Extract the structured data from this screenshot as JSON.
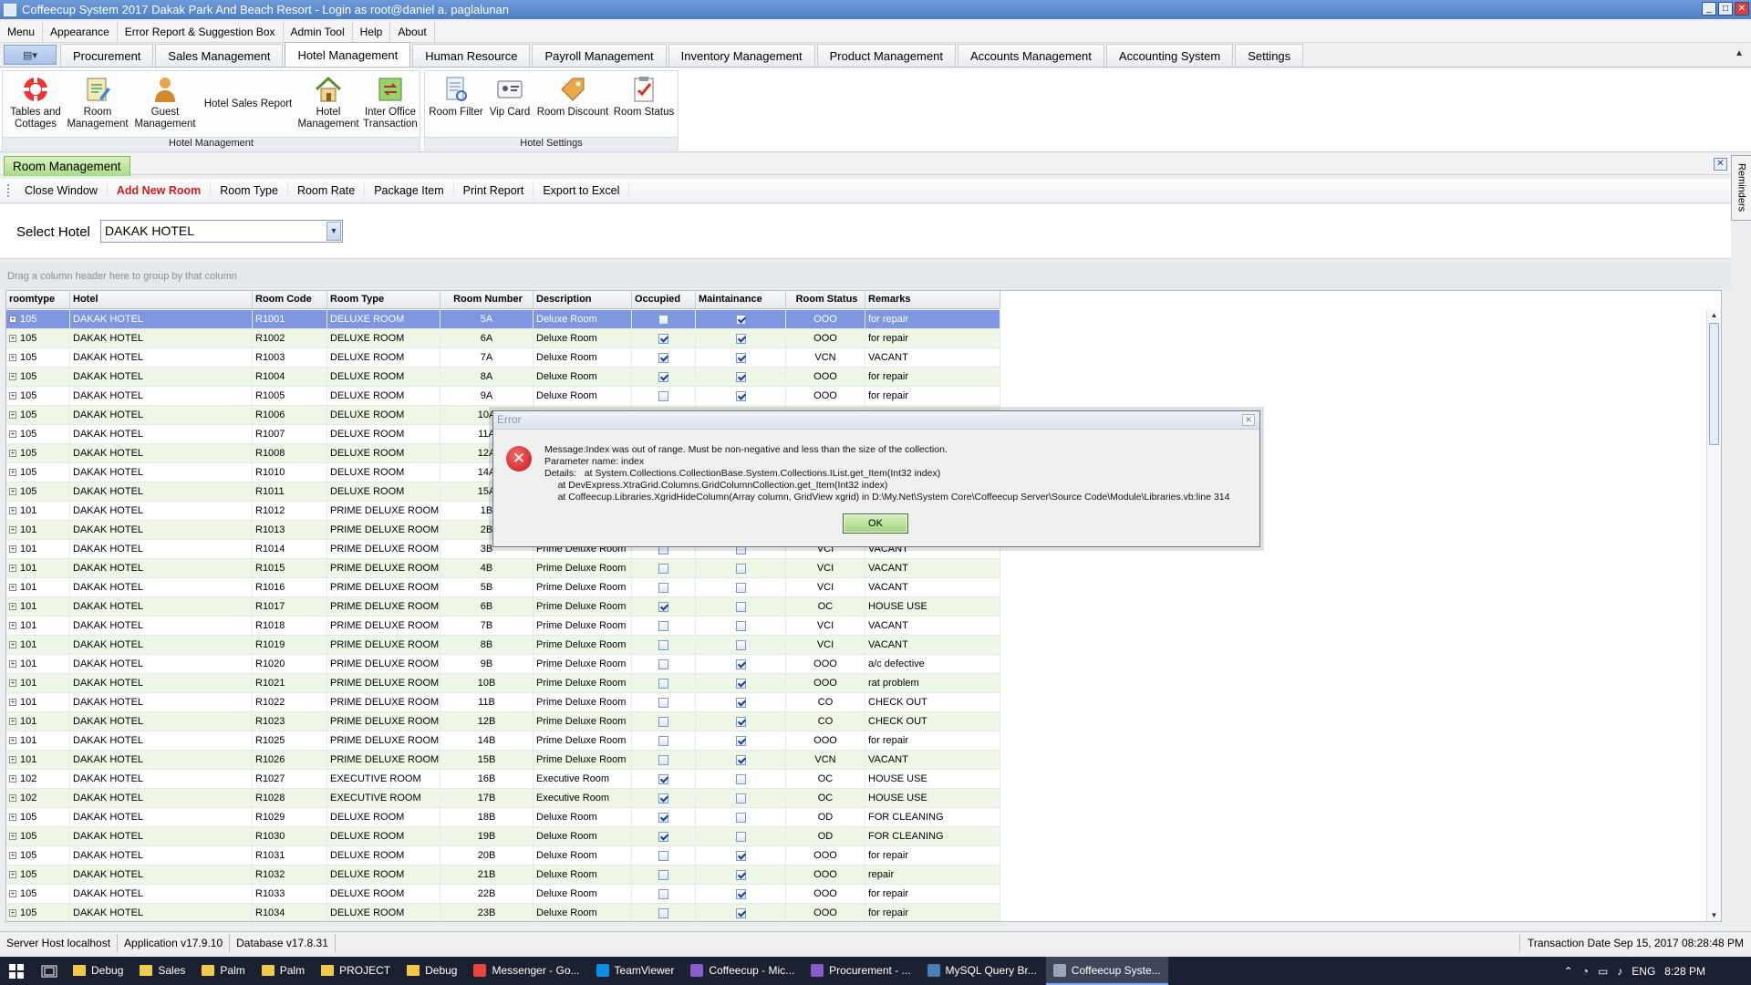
{
  "window": {
    "title": "Coffeecup System 2017 Dakak Park And Beach Resort - Login as root@daniel a. paglalunan"
  },
  "menu": [
    "Menu",
    "Appearance",
    "Error Report & Suggestion Box",
    "Admin Tool",
    "Help",
    "About"
  ],
  "tabs": [
    "Procurement",
    "Sales Management",
    "Hotel Management",
    "Human Resource",
    "Payroll Management",
    "Inventory Management",
    "Product Management",
    "Accounts Management",
    "Accounting System",
    "Settings"
  ],
  "ribbon": {
    "group1": {
      "caption": "Hotel Management",
      "buttons": [
        "Tables and Cottages",
        "Room Management",
        "Guest Management",
        "Hotel Sales Report",
        "Hotel Management",
        "Inter Office Transaction"
      ]
    },
    "group2": {
      "caption": "Hotel Settings",
      "buttons": [
        "Room Filter",
        "Vip Card",
        "Room Discount",
        "Room Status"
      ]
    }
  },
  "reminders": "Reminders",
  "window_tab": "Room Management",
  "toolbar": [
    "Close Window",
    "Add New Room",
    "Room Type",
    "Room Rate",
    "Package Item",
    "Print Report",
    "Export to Excel"
  ],
  "hotel_select": {
    "label": "Select Hotel",
    "value": "DAKAK HOTEL"
  },
  "group_hint": "Drag a column header here to group by that column",
  "columns": [
    "roomtype",
    "Hotel",
    "Room Code",
    "Room Type",
    "Room Number",
    "Description",
    "Occupied",
    "Maintainance",
    "Room Status",
    "Remarks"
  ],
  "rows": [
    [
      "105",
      "DAKAK HOTEL",
      "R1001",
      "DELUXE ROOM",
      "5A",
      "Deluxe Room",
      false,
      true,
      "OOO",
      "for repair"
    ],
    [
      "105",
      "DAKAK HOTEL",
      "R1002",
      "DELUXE ROOM",
      "6A",
      "Deluxe Room",
      true,
      true,
      "OOO",
      "for repair"
    ],
    [
      "105",
      "DAKAK HOTEL",
      "R1003",
      "DELUXE ROOM",
      "7A",
      "Deluxe Room",
      true,
      true,
      "VCN",
      "VACANT"
    ],
    [
      "105",
      "DAKAK HOTEL",
      "R1004",
      "DELUXE ROOM",
      "8A",
      "Deluxe Room",
      true,
      true,
      "OOO",
      "for repair"
    ],
    [
      "105",
      "DAKAK HOTEL",
      "R1005",
      "DELUXE ROOM",
      "9A",
      "Deluxe Room",
      false,
      true,
      "OOO",
      "for repair"
    ],
    [
      "105",
      "DAKAK HOTEL",
      "R1006",
      "DELUXE ROOM",
      "10A",
      "",
      false,
      false,
      "",
      ""
    ],
    [
      "105",
      "DAKAK HOTEL",
      "R1007",
      "DELUXE ROOM",
      "11A",
      "",
      false,
      false,
      "",
      ""
    ],
    [
      "105",
      "DAKAK HOTEL",
      "R1008",
      "DELUXE ROOM",
      "12A",
      "",
      false,
      false,
      "",
      ""
    ],
    [
      "105",
      "DAKAK HOTEL",
      "R1010",
      "DELUXE ROOM",
      "14A",
      "",
      false,
      false,
      "",
      ""
    ],
    [
      "105",
      "DAKAK HOTEL",
      "R1011",
      "DELUXE ROOM",
      "15A",
      "",
      false,
      false,
      "",
      ""
    ],
    [
      "101",
      "DAKAK HOTEL",
      "R1012",
      "PRIME DELUXE ROOM",
      "1B",
      "",
      false,
      false,
      "",
      ""
    ],
    [
      "101",
      "DAKAK HOTEL",
      "R1013",
      "PRIME DELUXE ROOM",
      "2B",
      "",
      false,
      false,
      "",
      ""
    ],
    [
      "101",
      "DAKAK HOTEL",
      "R1014",
      "PRIME DELUXE ROOM",
      "3B",
      "Prime Deluxe Room",
      false,
      false,
      "VCI",
      "VACANT"
    ],
    [
      "101",
      "DAKAK HOTEL",
      "R1015",
      "PRIME DELUXE ROOM",
      "4B",
      "Prime Deluxe Room",
      false,
      false,
      "VCI",
      "VACANT"
    ],
    [
      "101",
      "DAKAK HOTEL",
      "R1016",
      "PRIME DELUXE ROOM",
      "5B",
      "Prime Deluxe Room",
      false,
      false,
      "VCI",
      "VACANT"
    ],
    [
      "101",
      "DAKAK HOTEL",
      "R1017",
      "PRIME DELUXE ROOM",
      "6B",
      "Prime Deluxe Room",
      true,
      false,
      "OC",
      "HOUSE USE"
    ],
    [
      "101",
      "DAKAK HOTEL",
      "R1018",
      "PRIME DELUXE ROOM",
      "7B",
      "Prime Deluxe Room",
      false,
      false,
      "VCI",
      "VACANT"
    ],
    [
      "101",
      "DAKAK HOTEL",
      "R1019",
      "PRIME DELUXE ROOM",
      "8B",
      "Prime Deluxe Room",
      false,
      false,
      "VCI",
      "VACANT"
    ],
    [
      "101",
      "DAKAK HOTEL",
      "R1020",
      "PRIME DELUXE ROOM",
      "9B",
      "Prime Deluxe Room",
      false,
      true,
      "OOO",
      "a/c defective"
    ],
    [
      "101",
      "DAKAK HOTEL",
      "R1021",
      "PRIME DELUXE ROOM",
      "10B",
      "Prime Deluxe Room",
      false,
      true,
      "OOO",
      "rat problem"
    ],
    [
      "101",
      "DAKAK HOTEL",
      "R1022",
      "PRIME DELUXE ROOM",
      "11B",
      "Prime Deluxe Room",
      false,
      true,
      "CO",
      "CHECK OUT"
    ],
    [
      "101",
      "DAKAK HOTEL",
      "R1023",
      "PRIME DELUXE ROOM",
      "12B",
      "Prime Deluxe Room",
      false,
      true,
      "CO",
      "CHECK OUT"
    ],
    [
      "101",
      "DAKAK HOTEL",
      "R1025",
      "PRIME DELUXE ROOM",
      "14B",
      "Prime Deluxe Room",
      false,
      true,
      "OOO",
      "for repair"
    ],
    [
      "101",
      "DAKAK HOTEL",
      "R1026",
      "PRIME DELUXE ROOM",
      "15B",
      "Prime Deluxe Room",
      false,
      true,
      "VCN",
      "VACANT"
    ],
    [
      "102",
      "DAKAK HOTEL",
      "R1027",
      "EXECUTIVE ROOM",
      "16B",
      "Executive Room",
      true,
      false,
      "OC",
      "HOUSE USE"
    ],
    [
      "102",
      "DAKAK HOTEL",
      "R1028",
      "EXECUTIVE ROOM",
      "17B",
      "Executive Room",
      true,
      false,
      "OC",
      "HOUSE USE"
    ],
    [
      "105",
      "DAKAK HOTEL",
      "R1029",
      "DELUXE ROOM",
      "18B",
      "Deluxe Room",
      true,
      false,
      "OD",
      "FOR CLEANING"
    ],
    [
      "105",
      "DAKAK HOTEL",
      "R1030",
      "DELUXE ROOM",
      "19B",
      "Deluxe Room",
      true,
      false,
      "OD",
      "FOR CLEANING"
    ],
    [
      "105",
      "DAKAK HOTEL",
      "R1031",
      "DELUXE ROOM",
      "20B",
      "Deluxe Room",
      false,
      true,
      "OOO",
      "for repair"
    ],
    [
      "105",
      "DAKAK HOTEL",
      "R1032",
      "DELUXE ROOM",
      "21B",
      "Deluxe Room",
      false,
      true,
      "OOO",
      "repair"
    ],
    [
      "105",
      "DAKAK HOTEL",
      "R1033",
      "DELUXE ROOM",
      "22B",
      "Deluxe Room",
      false,
      true,
      "OOO",
      "for repair"
    ],
    [
      "105",
      "DAKAK HOTEL",
      "R1034",
      "DELUXE ROOM",
      "23B",
      "Deluxe Room",
      false,
      true,
      "OOO",
      "for repair"
    ]
  ],
  "selected_row": 0,
  "status": {
    "server": "Server Host localhost",
    "app": "Application v17.9.10",
    "db": "Database v17.8.31",
    "transaction": "Transaction Date  Sep 15, 2017 08:28:48 PM"
  },
  "dialog": {
    "title": "Error",
    "message": "Message:Index was out of range. Must be non-negative and less than the size of the collection.\nParameter name: index\nDetails:   at System.Collections.CollectionBase.System.Collections.IList.get_Item(Int32 index)\n     at DevExpress.XtraGrid.Columns.GridColumnCollection.get_Item(Int32 index)\n     at Coffeecup.Libraries.XgridHideColumn(Array column, GridView xgrid) in D:\\My.Net\\System Core\\Coffeecup Server\\Source Code\\Module\\Libraries.vb:line 314",
    "ok": "OK"
  },
  "taskbar": {
    "items": [
      "Debug",
      "Sales",
      "Palm",
      "Palm",
      "PROJECT",
      "Debug",
      "Messenger - Go...",
      "TeamViewer",
      "Coffeecup - Mic...",
      "Procurement - ...",
      "MySQL Query Br...",
      "Coffeecup Syste..."
    ],
    "lang": "ENG",
    "time": "8:28 PM"
  },
  "colors": {
    "accent": "#4f7fc6",
    "selected_row": "#7f97e0",
    "alt_row": "#eef6e5",
    "error": "#c91515"
  }
}
